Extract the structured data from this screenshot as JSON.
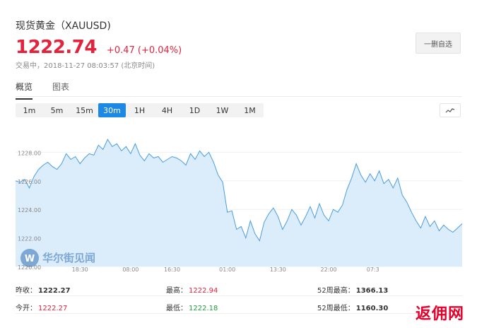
{
  "header": {
    "title": "现货黄金（XAUUSD)",
    "price": "1222.74",
    "change": "+0.47 (+0.04%)",
    "status": "交易中，2018-11-27 08:03:57 (北京时间)",
    "watch_label": "一删自选"
  },
  "tabs": [
    {
      "label": "概览",
      "active": true
    },
    {
      "label": "图表",
      "active": false
    }
  ],
  "periods": [
    {
      "label": "1m",
      "active": false
    },
    {
      "label": "5m",
      "active": false
    },
    {
      "label": "15m",
      "active": false
    },
    {
      "label": "30m",
      "active": true
    },
    {
      "label": "1H",
      "active": false
    },
    {
      "label": "4H",
      "active": false
    },
    {
      "label": "1D",
      "active": false
    },
    {
      "label": "1W",
      "active": false
    },
    {
      "label": "1M",
      "active": false
    }
  ],
  "chart_type_icon": "line-chart-icon",
  "watermark": "华尔街见闻",
  "chart_data": {
    "type": "area",
    "ylim": [
      1220.0,
      1230.0
    ],
    "yticks": [
      "1228.00",
      "1226.00",
      "1224.00",
      "1222.00",
      "1220.00"
    ],
    "ytick_values": [
      1228,
      1226,
      1224,
      1222,
      1220
    ],
    "xticks": [
      "18:30",
      "08:00",
      "16:30",
      "01:00",
      "13:30",
      "22:00",
      "07:3"
    ],
    "xtick_index": [
      14,
      25,
      34,
      46,
      57,
      68,
      79
    ],
    "values": [
      1226.0,
      1225.9,
      1226.1,
      1225.5,
      1226.3,
      1226.8,
      1227.1,
      1227.3,
      1227.0,
      1226.8,
      1227.2,
      1227.9,
      1227.5,
      1227.7,
      1227.2,
      1227.6,
      1227.9,
      1227.8,
      1228.5,
      1228.2,
      1228.9,
      1228.4,
      1228.6,
      1228.1,
      1228.4,
      1227.9,
      1228.6,
      1227.8,
      1227.4,
      1227.9,
      1227.6,
      1227.7,
      1227.3,
      1227.5,
      1227.7,
      1227.6,
      1227.4,
      1227.1,
      1227.9,
      1227.5,
      1228.1,
      1227.7,
      1228.0,
      1227.3,
      1226.4,
      1225.9,
      1223.8,
      1223.9,
      1222.6,
      1222.8,
      1222.0,
      1223.2,
      1222.3,
      1221.8,
      1223.1,
      1223.7,
      1224.1,
      1223.5,
      1222.6,
      1223.2,
      1224.0,
      1223.6,
      1222.9,
      1223.5,
      1224.2,
      1223.4,
      1224.4,
      1223.6,
      1223.2,
      1224.0,
      1223.8,
      1224.3,
      1225.4,
      1226.2,
      1227.2,
      1226.4,
      1225.9,
      1226.5,
      1226.0,
      1226.7,
      1225.8,
      1226.1,
      1225.5,
      1226.2,
      1225.0,
      1224.5,
      1223.8,
      1223.2,
      1222.7,
      1223.5,
      1222.8,
      1223.2,
      1222.5,
      1222.9,
      1222.6,
      1222.4,
      1222.7,
      1223.0
    ],
    "grid": true
  },
  "stats": {
    "rows": [
      [
        {
          "label": "昨收：",
          "value": "1222.27",
          "tone": "dark"
        },
        {
          "label": "最高：",
          "value": "1222.94",
          "tone": "red"
        },
        {
          "label": "52周最高：",
          "value": "1366.13",
          "tone": "dark"
        }
      ],
      [
        {
          "label": "今开：",
          "value": "1222.27",
          "tone": "red"
        },
        {
          "label": "最低：",
          "value": "1222.18",
          "tone": "green"
        },
        {
          "label": "52周最低：",
          "value": "1160.30",
          "tone": "dark"
        }
      ]
    ]
  },
  "corner_mark": "返佣网",
  "colors": {
    "up": "#e2233e",
    "down": "#1e9e3e",
    "accent": "#1e88e5",
    "line": "#4a9de0",
    "fill": "#dbecfb"
  }
}
